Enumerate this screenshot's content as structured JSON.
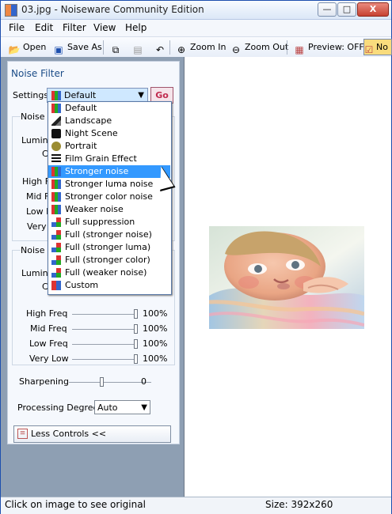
{
  "window": {
    "title": "03.jpg - Noiseware Community Edition",
    "buttons": {
      "minimize": "—",
      "maximize": "□",
      "close": "X"
    }
  },
  "menu": {
    "items": [
      "File",
      "Edit",
      "Filter",
      "View",
      "Help"
    ]
  },
  "toolbar": {
    "open": "Open",
    "save_as": "Save As",
    "zoom_in": "Zoom In",
    "zoom_out": "Zoom Out",
    "preview": "Preview: OFF",
    "preview_button": "No"
  },
  "panel": {
    "title": "Noise Filter",
    "settings_label": "Settings",
    "settings_value": "Default",
    "go": "Go",
    "noise_level_title": "Noise L",
    "noise_spectrum_title": "Noise S",
    "luminance_label": "Lumina",
    "color_label": "C",
    "freq_labels": [
      "High F",
      "Mid F",
      "Low F",
      "Very"
    ],
    "spectrum_rows": [
      {
        "label": "High Freq",
        "value": "100%"
      },
      {
        "label": "Mid Freq",
        "value": "100%"
      },
      {
        "label": "Low Freq",
        "value": "100%"
      },
      {
        "label": "Very Low",
        "value": "100%"
      }
    ],
    "sharpening_label": "Sharpening",
    "sharpening_value": "0",
    "processing_label": "Processing Degree",
    "processing_value": "Auto",
    "less_controls": "Less Controls <<"
  },
  "dropdown": {
    "options": [
      "Default",
      "Landscape",
      "Night Scene",
      "Portrait",
      "Film Grain Effect",
      "Stronger noise",
      "Stronger luma noise",
      "Stronger color noise",
      "Weaker noise",
      "Full suppression",
      "Full (stronger noise)",
      "Full (stronger luma)",
      "Full (stronger color)",
      "Full (weaker noise)",
      "Custom"
    ],
    "selected": "Stronger noise"
  },
  "status": {
    "left": "Click on image to see original",
    "right": "Size: 392x260"
  },
  "colors": {
    "selection": "#3399ff",
    "accent": "#1b4c87",
    "go_text": "#c02b4f"
  }
}
